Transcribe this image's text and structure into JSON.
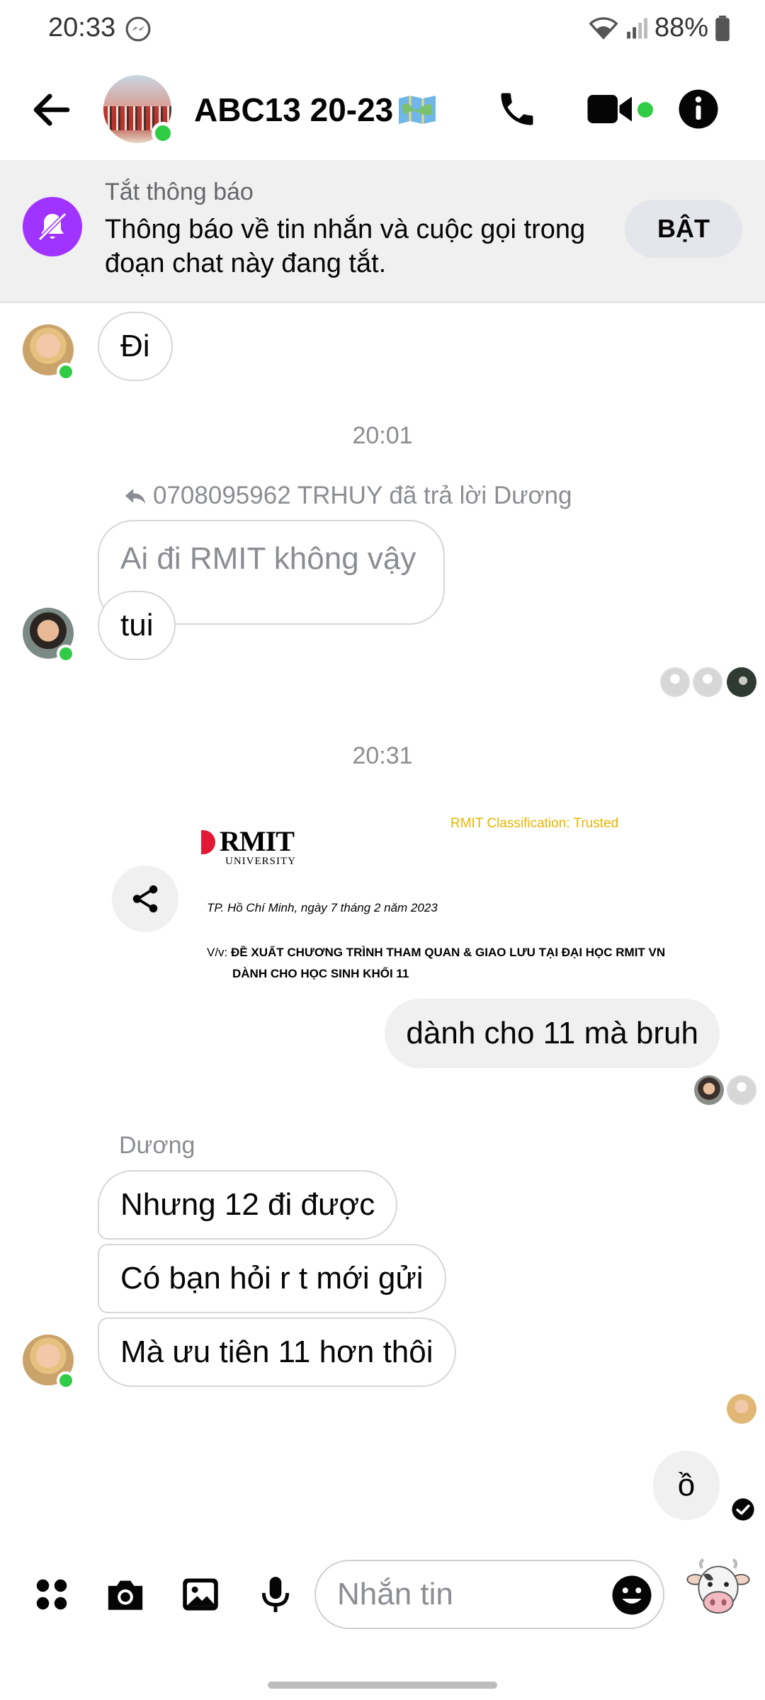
{
  "status_bar": {
    "time": "20:33",
    "battery": "88%"
  },
  "header": {
    "title": "ABC13 20-23",
    "title_emoji": "map-emoji"
  },
  "mute_banner": {
    "title": "Tắt thông báo",
    "body": "Thông báo về tin nhắn và cuộc gọi trong đoạn chat này đang tắt.",
    "button": "BẬT"
  },
  "messages": {
    "msg_di": "Đi",
    "time_1": "20:01",
    "reply_note": "0708095962 TRHUY đã trả lời Dương",
    "quoted": "Ai đi RMIT không vậy",
    "reply": "tui",
    "time_2": "20:31",
    "shared_doc": {
      "logo": "RMIT",
      "logo_sub": "UNIVERSITY",
      "classification": "RMIT Classification: Trusted",
      "date_line": "TP. Hồ Chí Minh, ngày 7 tháng 2 năm 2023",
      "subject_prefix": "V/v:",
      "subject_line1": "ĐỀ XUẤT CHƯƠNG TRÌNH THAM QUAN & GIAO LƯU TẠI ĐẠI HỌC RMIT VN",
      "subject_line2": "DÀNH CHO HỌC SINH KHỐI 11"
    },
    "mine_1": "dành cho 11 mà bruh",
    "sender": "Dương",
    "duong_1": "Nhưng 12 đi được",
    "duong_2": "Có bạn hỏi r t mới gửi",
    "duong_3": "Mà ưu tiên 11 hơn thôi",
    "mine_2": "ồ"
  },
  "composer": {
    "placeholder": "Nhắn tin"
  },
  "colors": {
    "online": "#31cc46",
    "mute_icon_bg": "#a033ff",
    "bubble_mine": "#f0f0f0",
    "meta_text": "#8a8d91"
  }
}
